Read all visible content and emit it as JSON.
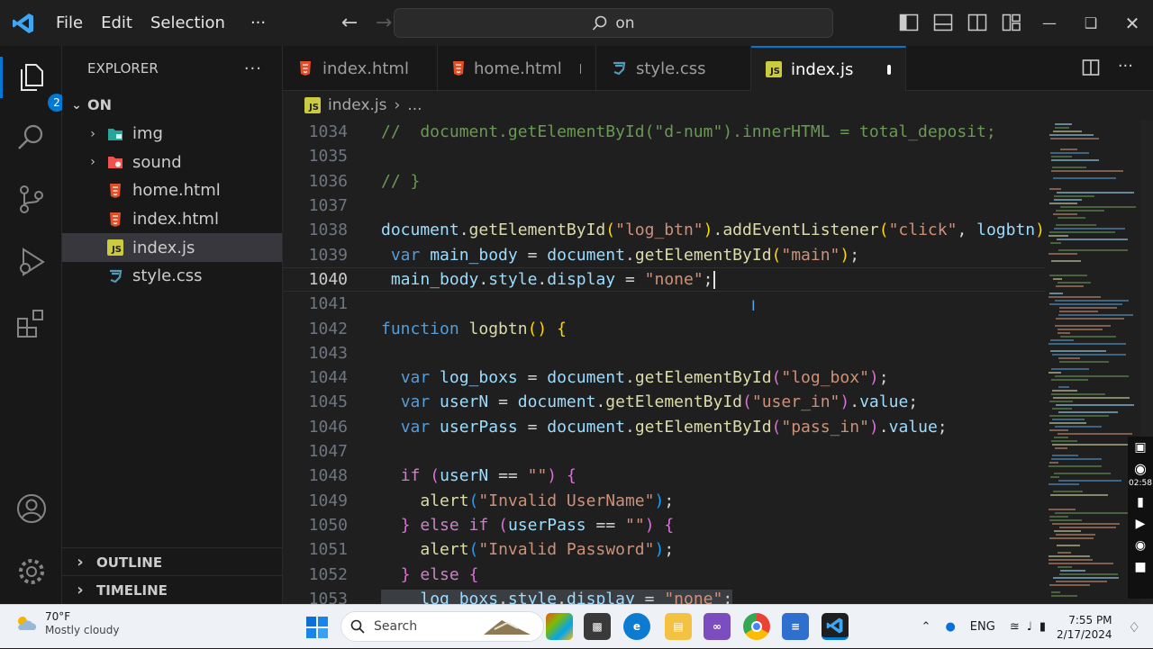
{
  "titlebar": {
    "menu": [
      "File",
      "Edit",
      "Selection",
      "···"
    ],
    "search_text": "on"
  },
  "activity": {
    "explorer_badge": "2"
  },
  "sidebar": {
    "title": "EXPLORER",
    "more": "···",
    "root": "ON",
    "items": [
      {
        "label": "img",
        "type": "folder"
      },
      {
        "label": "sound",
        "type": "folder"
      },
      {
        "label": "home.html",
        "type": "html"
      },
      {
        "label": "index.html",
        "type": "html"
      },
      {
        "label": "index.js",
        "type": "js"
      },
      {
        "label": "style.css",
        "type": "css"
      }
    ],
    "outline": "OUTLINE",
    "timeline": "TIMELINE"
  },
  "tabs": [
    {
      "label": "index.html",
      "type": "html",
      "modified": false
    },
    {
      "label": "home.html",
      "type": "html",
      "modified": true
    },
    {
      "label": "style.css",
      "type": "css",
      "modified": false
    },
    {
      "label": "index.js",
      "type": "js",
      "modified": true,
      "active": true
    }
  ],
  "breadcrumb": {
    "file": "index.js",
    "rest": "..."
  },
  "editor": {
    "lines": [
      {
        "n": "1034",
        "tokens": [
          [
            "c",
            "//  document.getElementById(\"d-num\").innerHTML = total_deposit;"
          ]
        ]
      },
      {
        "n": "1035",
        "tokens": []
      },
      {
        "n": "1036",
        "tokens": [
          [
            "c",
            "// }"
          ]
        ]
      },
      {
        "n": "1037",
        "tokens": []
      },
      {
        "n": "1038",
        "tokens": [
          [
            "v",
            "document"
          ],
          [
            "p",
            "."
          ],
          [
            "f",
            "getElementById"
          ],
          [
            "b1",
            "("
          ],
          [
            "s",
            "\"log_btn\""
          ],
          [
            "b1",
            ")"
          ],
          [
            "p",
            "."
          ],
          [
            "f",
            "addEventListener"
          ],
          [
            "b1",
            "("
          ],
          [
            "s",
            "\"click\""
          ],
          [
            "p",
            ", "
          ],
          [
            "v",
            "logbtn"
          ],
          [
            "b1",
            ")"
          ],
          [
            "p",
            ";"
          ]
        ]
      },
      {
        "n": "1039",
        "tokens": [
          [
            "p",
            " "
          ],
          [
            "k",
            "var"
          ],
          [
            "p",
            " "
          ],
          [
            "v",
            "main_body"
          ],
          [
            "p",
            " = "
          ],
          [
            "v",
            "document"
          ],
          [
            "p",
            "."
          ],
          [
            "f",
            "getElementById"
          ],
          [
            "b1",
            "("
          ],
          [
            "s",
            "\"main\""
          ],
          [
            "b1",
            ")"
          ],
          [
            "p",
            ";"
          ]
        ]
      },
      {
        "n": "1040",
        "tokens": [
          [
            "p",
            " "
          ],
          [
            "v",
            "main_body"
          ],
          [
            "p",
            "."
          ],
          [
            "v",
            "style"
          ],
          [
            "p",
            "."
          ],
          [
            "v",
            "display"
          ],
          [
            "p",
            " = "
          ],
          [
            "s",
            "\"none\""
          ],
          [
            "p",
            ";"
          ]
        ],
        "cursor": true
      },
      {
        "n": "1041",
        "tokens": []
      },
      {
        "n": "1042",
        "tokens": [
          [
            "k",
            "function"
          ],
          [
            "p",
            " "
          ],
          [
            "f",
            "logbtn"
          ],
          [
            "b1",
            "()"
          ],
          [
            "p",
            " "
          ],
          [
            "b1",
            "{"
          ]
        ]
      },
      {
        "n": "1043",
        "tokens": []
      },
      {
        "n": "1044",
        "tokens": [
          [
            "p",
            "  "
          ],
          [
            "k",
            "var"
          ],
          [
            "p",
            " "
          ],
          [
            "v",
            "log_boxs"
          ],
          [
            "p",
            " = "
          ],
          [
            "v",
            "document"
          ],
          [
            "p",
            "."
          ],
          [
            "f",
            "getElementById"
          ],
          [
            "b2",
            "("
          ],
          [
            "s",
            "\"log_box\""
          ],
          [
            "b2",
            ")"
          ],
          [
            "p",
            ";"
          ]
        ]
      },
      {
        "n": "1045",
        "tokens": [
          [
            "p",
            "  "
          ],
          [
            "k",
            "var"
          ],
          [
            "p",
            " "
          ],
          [
            "v",
            "userN"
          ],
          [
            "p",
            " = "
          ],
          [
            "v",
            "document"
          ],
          [
            "p",
            "."
          ],
          [
            "f",
            "getElementById"
          ],
          [
            "b2",
            "("
          ],
          [
            "s",
            "\"user_in\""
          ],
          [
            "b2",
            ")"
          ],
          [
            "p",
            "."
          ],
          [
            "v",
            "value"
          ],
          [
            "p",
            ";"
          ]
        ]
      },
      {
        "n": "1046",
        "tokens": [
          [
            "p",
            "  "
          ],
          [
            "k",
            "var"
          ],
          [
            "p",
            " "
          ],
          [
            "v",
            "userPass"
          ],
          [
            "p",
            " = "
          ],
          [
            "v",
            "document"
          ],
          [
            "p",
            "."
          ],
          [
            "f",
            "getElementById"
          ],
          [
            "b2",
            "("
          ],
          [
            "s",
            "\"pass_in\""
          ],
          [
            "b2",
            ")"
          ],
          [
            "p",
            "."
          ],
          [
            "v",
            "value"
          ],
          [
            "p",
            ";"
          ]
        ]
      },
      {
        "n": "1047",
        "tokens": []
      },
      {
        "n": "1048",
        "tokens": [
          [
            "p",
            "  "
          ],
          [
            "x",
            "if"
          ],
          [
            "p",
            " "
          ],
          [
            "b2",
            "("
          ],
          [
            "v",
            "userN"
          ],
          [
            "p",
            " == "
          ],
          [
            "s",
            "\"\""
          ],
          [
            "b2",
            ")"
          ],
          [
            "p",
            " "
          ],
          [
            "b2",
            "{"
          ]
        ]
      },
      {
        "n": "1049",
        "tokens": [
          [
            "p",
            "    "
          ],
          [
            "f",
            "alert"
          ],
          [
            "b3",
            "("
          ],
          [
            "s",
            "\"Invalid UserName\""
          ],
          [
            "b3",
            ")"
          ],
          [
            "p",
            ";"
          ]
        ]
      },
      {
        "n": "1050",
        "tokens": [
          [
            "p",
            "  "
          ],
          [
            "b2",
            "}"
          ],
          [
            "p",
            " "
          ],
          [
            "x",
            "else"
          ],
          [
            "p",
            " "
          ],
          [
            "x",
            "if"
          ],
          [
            "p",
            " "
          ],
          [
            "b2",
            "("
          ],
          [
            "v",
            "userPass"
          ],
          [
            "p",
            " == "
          ],
          [
            "s",
            "\"\""
          ],
          [
            "b2",
            ")"
          ],
          [
            "p",
            " "
          ],
          [
            "b2",
            "{"
          ]
        ]
      },
      {
        "n": "1051",
        "tokens": [
          [
            "p",
            "    "
          ],
          [
            "f",
            "alert"
          ],
          [
            "b3",
            "("
          ],
          [
            "s",
            "\"Invalid Password\""
          ],
          [
            "b3",
            ")"
          ],
          [
            "p",
            ";"
          ]
        ]
      },
      {
        "n": "1052",
        "tokens": [
          [
            "p",
            "  "
          ],
          [
            "b2",
            "}"
          ],
          [
            "p",
            " "
          ],
          [
            "x",
            "else"
          ],
          [
            "p",
            " "
          ],
          [
            "b2",
            "{"
          ]
        ]
      },
      {
        "n": "1053",
        "tokens": [
          [
            "p",
            "    "
          ],
          [
            "v",
            "log_boxs"
          ],
          [
            "p",
            "."
          ],
          [
            "v",
            "style"
          ],
          [
            "p",
            "."
          ],
          [
            "v",
            "display"
          ],
          [
            "p",
            " = "
          ],
          [
            "s",
            "\"none\""
          ],
          [
            "p",
            ";"
          ]
        ],
        "highlight": true
      }
    ],
    "current_line": "1040"
  },
  "taskbar": {
    "weather_temp": "70°F",
    "weather_desc": "Mostly cloudy",
    "search_label": "Search",
    "lang": "ENG",
    "time": "7:55 PM",
    "date": "2/17/2024",
    "rec_time": "02:58"
  },
  "colors": {
    "accent": "#0078d4",
    "html_icon": "#e44d26",
    "css_icon": "#519aba",
    "js_icon": "#cbcb41"
  }
}
